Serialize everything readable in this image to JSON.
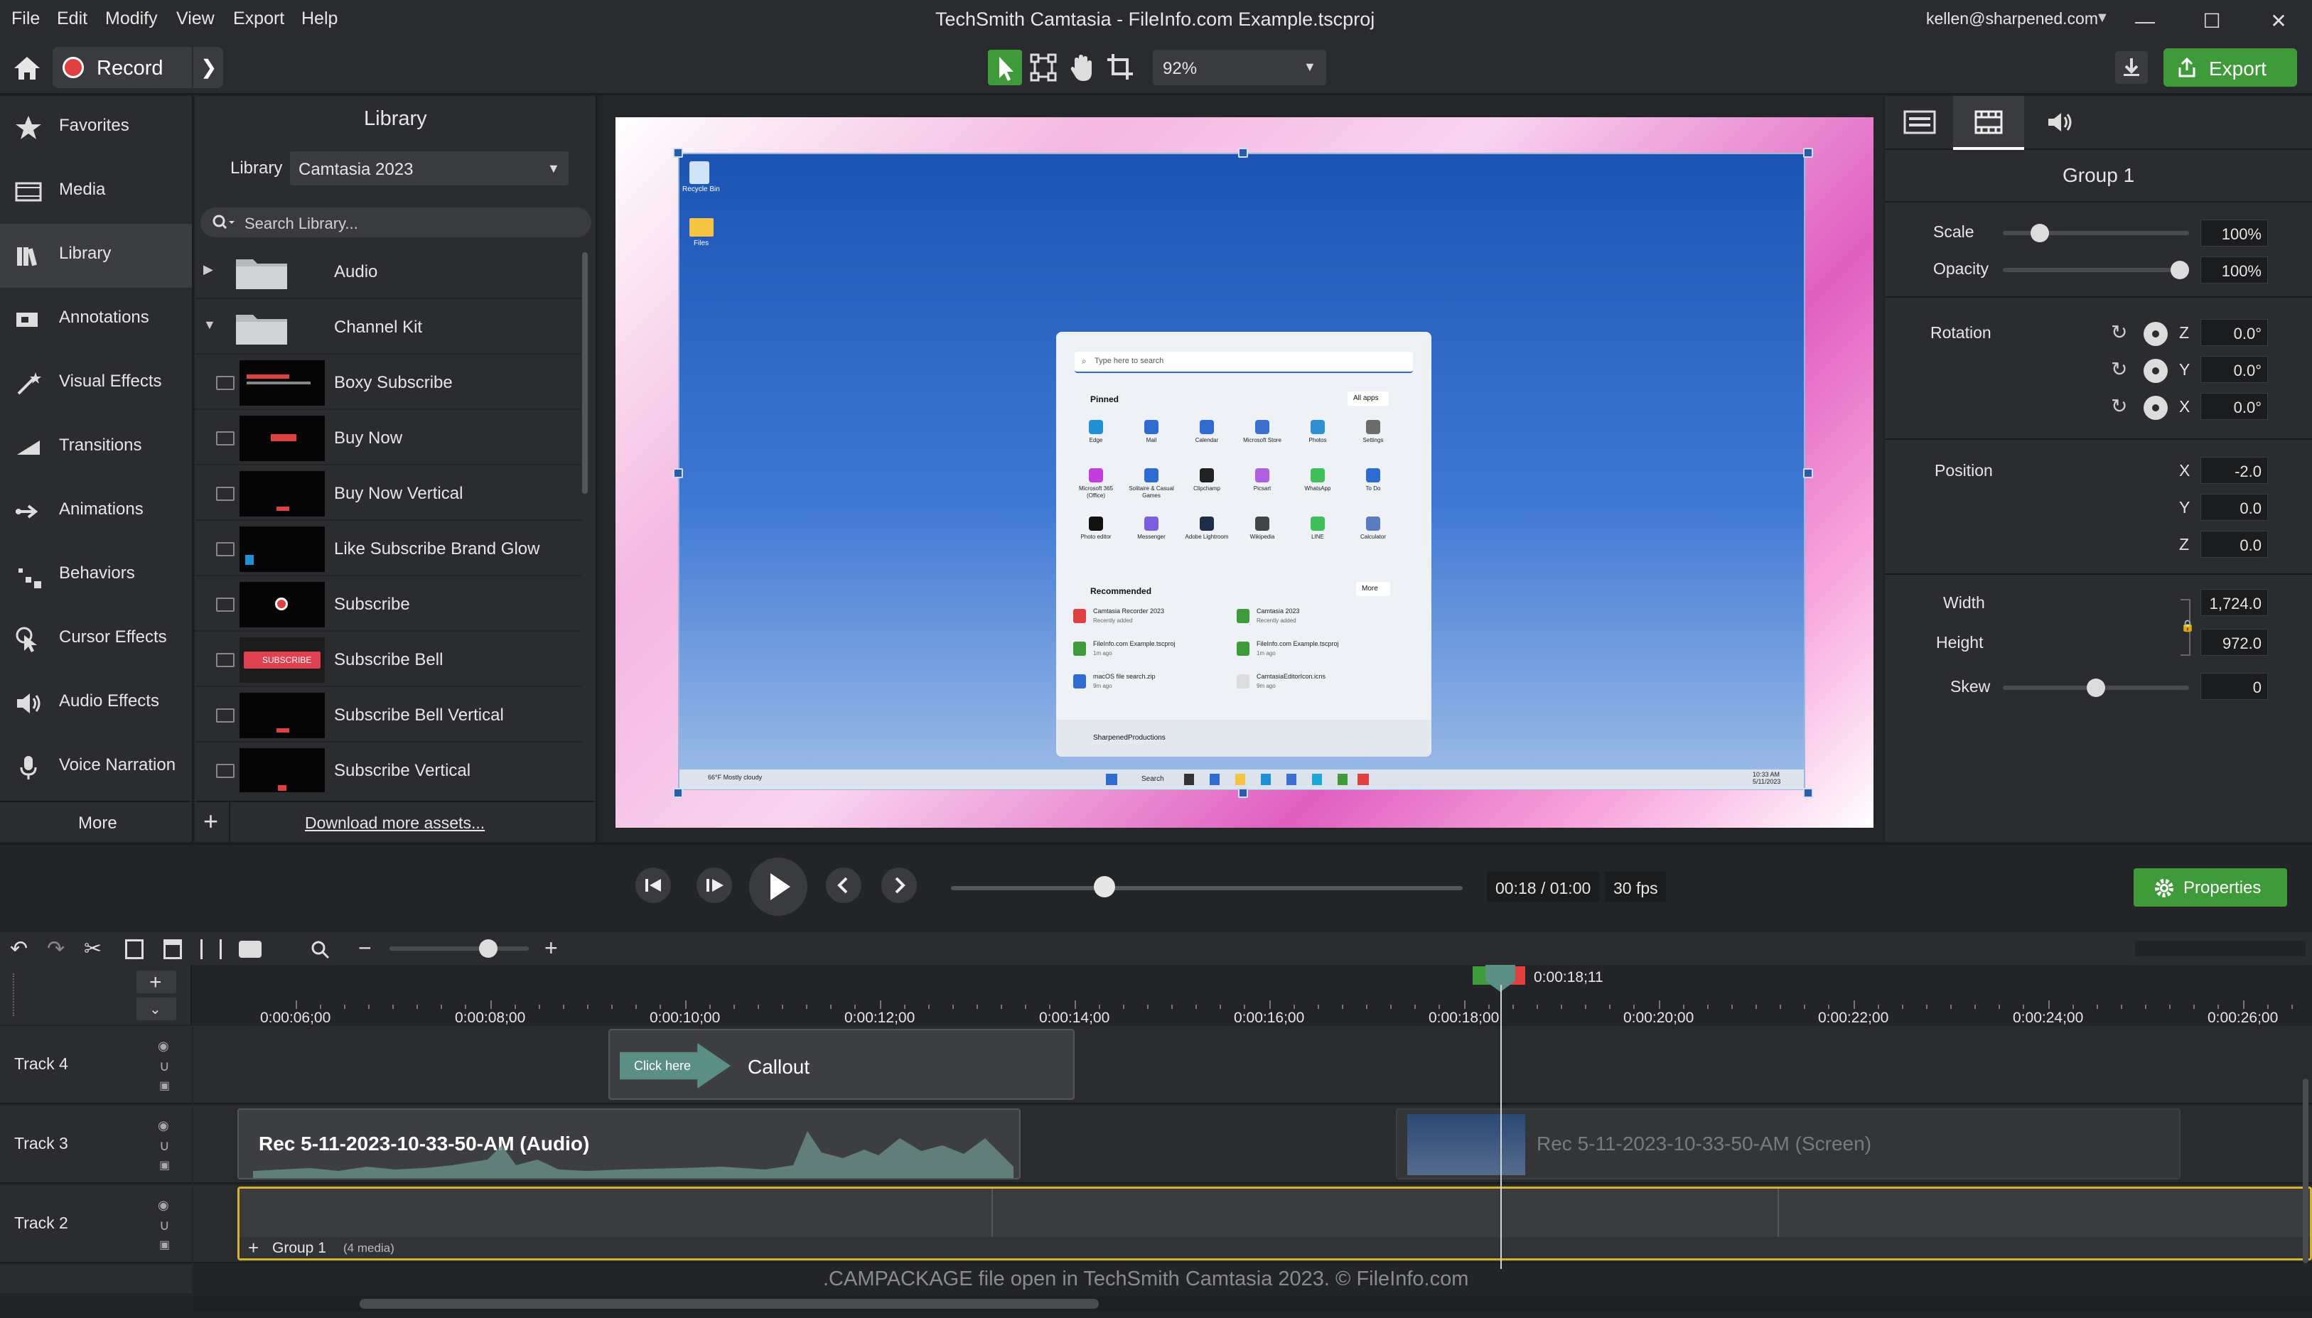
{
  "menu": [
    "File",
    "Edit",
    "Modify",
    "View",
    "Export",
    "Help"
  ],
  "window_title": "TechSmith Camtasia - FileInfo.com Example.tscproj",
  "account": "kellen@sharpened.com",
  "toolbar": {
    "record_label": "Record",
    "zoom": "92%",
    "export_label": "Export"
  },
  "nav": [
    {
      "label": "Favorites",
      "icon": "star-icon"
    },
    {
      "label": "Media",
      "icon": "film-icon"
    },
    {
      "label": "Library",
      "icon": "books-icon"
    },
    {
      "label": "Annotations",
      "icon": "annotation-icon"
    },
    {
      "label": "Visual Effects",
      "icon": "wand-icon"
    },
    {
      "label": "Transitions",
      "icon": "transition-icon"
    },
    {
      "label": "Animations",
      "icon": "arrow-icon"
    },
    {
      "label": "Behaviors",
      "icon": "behavior-icon"
    },
    {
      "label": "Cursor Effects",
      "icon": "cursor-icon"
    },
    {
      "label": "Audio Effects",
      "icon": "speaker-icon"
    },
    {
      "label": "Voice Narration",
      "icon": "mic-icon"
    }
  ],
  "nav_more": "More",
  "library": {
    "title": "Library",
    "selector_label": "Library",
    "selector_value": "Camtasia 2023",
    "search_placeholder": "Search Library...",
    "folders": [
      "Audio",
      "Channel Kit"
    ],
    "items": [
      "Boxy Subscribe",
      "Buy Now",
      "Buy Now Vertical",
      "Like Subscribe Brand Glow",
      "Subscribe",
      "Subscribe Bell",
      "Subscribe Bell Vertical",
      "Subscribe Vertical"
    ],
    "thumb_text": "SUBSCRIBE",
    "download": "Download more assets..."
  },
  "preview": {
    "search_hint": "Type here to search",
    "pinned": "Pinned",
    "all_apps": "All apps",
    "recommended": "Recommended",
    "more": "More",
    "user": "SharpenedProductions",
    "apps_row1": [
      "Edge",
      "Mail",
      "Calendar",
      "Microsoft Store",
      "Photos",
      "Settings"
    ],
    "apps_row2": [
      "Microsoft 365 (Office)",
      "Solitaire & Casual Games",
      "Clipchamp",
      "Picsart",
      "WhatsApp",
      "To Do"
    ],
    "apps_row3": [
      "Photo editor",
      "Messenger",
      "Adobe Lightroom",
      "Wikipedia",
      "LINE",
      "Calculator"
    ],
    "recs": [
      {
        "name": "Camtasia Recorder 2023",
        "sub": "Recently added"
      },
      {
        "name": "Camtasia 2023",
        "sub": "Recently added"
      },
      {
        "name": "FileInfo.com Example.tscproj",
        "sub": "1m ago"
      },
      {
        "name": "FileInfo.com Example.tscproj",
        "sub": "1m ago"
      },
      {
        "name": "macOS file search.zip",
        "sub": "9m ago"
      },
      {
        "name": "CamtasiaEditorIcon.icns",
        "sub": "9m ago"
      }
    ],
    "desktop_icons": [
      "Recycle Bin",
      "Files"
    ],
    "weather": "66°F Mostly cloudy",
    "taskbar_search": "Search",
    "clock": "10:33 AM 5/11/2023"
  },
  "props": {
    "title": "Group 1",
    "scale_label": "Scale",
    "scale": "100%",
    "opacity_label": "Opacity",
    "opacity": "100%",
    "rotation_label": "Rotation",
    "rot_z": "0.0°",
    "rot_y": "0.0°",
    "rot_x": "0.0°",
    "position_label": "Position",
    "pos_x": "-2.0",
    "pos_y": "0.0",
    "pos_z": "0.0",
    "width_label": "Width",
    "width": "1,724.0",
    "height_label": "Height",
    "height": "972.0",
    "skew_label": "Skew",
    "skew": "0",
    "z": "Z",
    "y": "Y",
    "x": "X",
    "scale_level": 0.2,
    "opacity_level": 0.95,
    "skew_level": 0.5,
    "properties_button": "Properties"
  },
  "playback": {
    "time": "00:18 / 01:00",
    "fps": "30 fps",
    "progress": 0.3
  },
  "timeline": {
    "playhead": "0:00:18;11",
    "ruler": [
      "0:00:06;00",
      "0:00:08;00",
      "0:00:10;00",
      "0:00:12;00",
      "0:00:14;00",
      "0:00:16;00",
      "0:00:18;00",
      "0:00:20;00",
      "0:00:22;00",
      "0:00:24;00",
      "0:00:26;00"
    ],
    "tracks": [
      "Track 4",
      "Track 3",
      "Track 2"
    ],
    "callout_text": "Click here",
    "callout_label": "Callout",
    "audio_clip": "Rec 5-11-2023-10-33-50-AM (Audio)",
    "screen_clip": "Rec 5-11-2023-10-33-50-AM (Screen)",
    "group_label": "Group 1",
    "group_count": "(4 media)"
  },
  "watermark": ".CAMPACKAGE file open in TechSmith Camtasia 2023. © FileInfo.com",
  "colors": {
    "accent_green": "#3f9b3a",
    "record_red": "#e04040",
    "clip_teal": "#5b8f85"
  }
}
